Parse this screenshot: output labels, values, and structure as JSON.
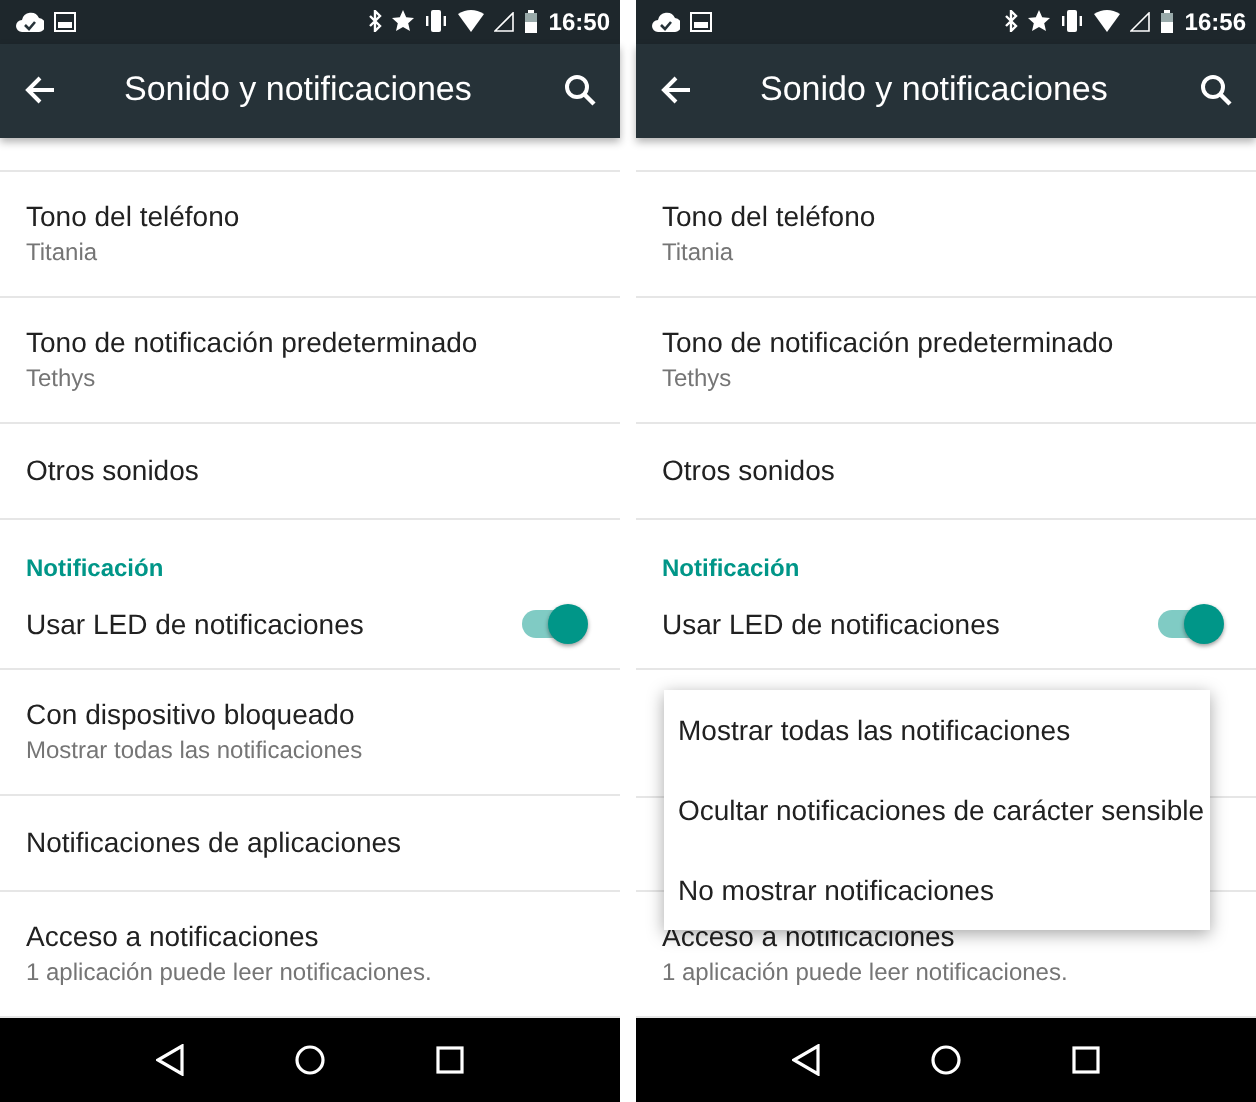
{
  "screens": [
    {
      "status_bar": {
        "time": "16:50"
      },
      "toolbar": {
        "title": "Sonido y notificaciones"
      },
      "items": [
        {
          "kind": "setting",
          "title": "Tono del teléfono",
          "summary": "Titania"
        },
        {
          "kind": "setting",
          "title": "Tono de notificación predeterminado",
          "summary": "Tethys"
        },
        {
          "kind": "setting",
          "title": "Otros sonidos"
        },
        {
          "kind": "header",
          "title": "Notificación"
        },
        {
          "kind": "toggle",
          "title": "Usar LED de notificaciones",
          "on": true
        },
        {
          "kind": "setting",
          "title": "Con dispositivo bloqueado",
          "summary": "Mostrar todas las notificaciones"
        },
        {
          "kind": "setting",
          "title": "Notificaciones de aplicaciones"
        },
        {
          "kind": "setting",
          "title": "Acceso a notificaciones",
          "summary": "1 aplicación puede leer notificaciones."
        }
      ]
    },
    {
      "status_bar": {
        "time": "16:56"
      },
      "toolbar": {
        "title": "Sonido y notificaciones"
      },
      "items": [
        {
          "kind": "setting",
          "title": "Tono del teléfono",
          "summary": "Titania"
        },
        {
          "kind": "setting",
          "title": "Tono de notificación predeterminado",
          "summary": "Tethys"
        },
        {
          "kind": "setting",
          "title": "Otros sonidos"
        },
        {
          "kind": "header",
          "title": "Notificación"
        },
        {
          "kind": "toggle",
          "title": "Usar LED de notificaciones",
          "on": true
        },
        {
          "kind": "hidden"
        },
        {
          "kind": "hidden"
        },
        {
          "kind": "setting",
          "title": "Acceso a notificaciones",
          "summary": "1 aplicación puede leer notificaciones."
        }
      ],
      "menu": {
        "items": [
          {
            "label": "Mostrar todas las notificaciones"
          },
          {
            "label": "Ocultar notificaciones de carácter sensible"
          },
          {
            "label": "No mostrar notificaciones"
          }
        ]
      }
    }
  ]
}
